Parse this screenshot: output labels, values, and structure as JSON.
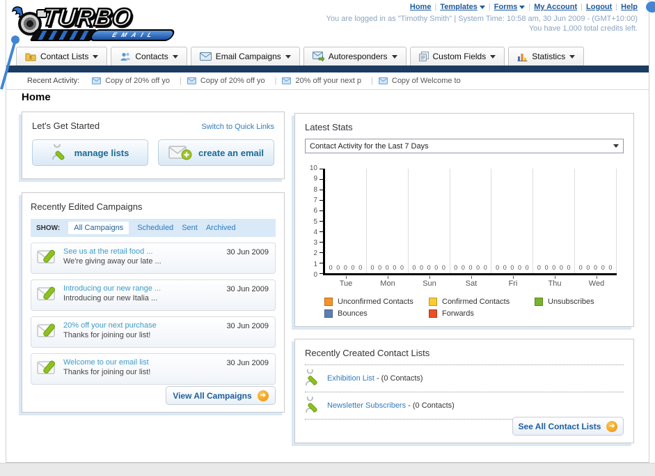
{
  "header": {
    "logo": {
      "top": "TURBO",
      "bottom": "EMAIL"
    },
    "nav": {
      "home": "Home",
      "templates": "Templates",
      "forms": "Forms",
      "my_account": "My Account",
      "logout": "Logout",
      "help": "Help"
    },
    "login_info": "You are logged in as \"Timothy Smith\" | System Time: 10:58 am, 30 Jun 2009 - (GMT+10:00)",
    "credits": "You have 1,000 total credits left."
  },
  "tabs": [
    {
      "label": "Contact Lists"
    },
    {
      "label": "Contacts"
    },
    {
      "label": "Email Campaigns"
    },
    {
      "label": "Autoresponders"
    },
    {
      "label": "Custom Fields"
    },
    {
      "label": "Statistics"
    }
  ],
  "recent_activity": {
    "label": "Recent Activity:",
    "items": [
      "Copy of 20% off yo",
      "Copy of 20% off yo",
      "20% off your next p",
      "Copy of Welcome to"
    ]
  },
  "page": {
    "title": "Home"
  },
  "get_started": {
    "title": "Let's Get Started",
    "switch_link": "Switch to Quick Links",
    "manage_lists_label": "manage lists",
    "create_email_label": "create an email"
  },
  "campaigns": {
    "title": "Recently Edited Campaigns",
    "show_label": "SHOW:",
    "filters": [
      "All Campaigns",
      "Scheduled",
      "Sent",
      "Archived"
    ],
    "active_filter": "All Campaigns",
    "items": [
      {
        "title": "See us at the retail food ...",
        "subtitle": "We're giving away our late ...",
        "date": "30 Jun 2009"
      },
      {
        "title": "Introducing our new range ...",
        "subtitle": "Introducing our new Italia ...",
        "date": "30 Jun 2009"
      },
      {
        "title": "20% off your next purchase",
        "subtitle": "Thanks for joining our list!",
        "date": "30 Jun 2009"
      },
      {
        "title": "Welcome to our email list",
        "subtitle": "Thanks for joining our list!",
        "date": "30 Jun 2009"
      }
    ],
    "view_all_label": "View All Campaigns"
  },
  "stats": {
    "title": "Latest Stats",
    "period_selected": "Contact Activity for the Last 7 Days"
  },
  "chart_data": {
    "type": "bar",
    "title": "Contact Activity for the Last 7 Days",
    "categories": [
      "Tue",
      "Mon",
      "Sun",
      "Sat",
      "Fri",
      "Thu",
      "Wed"
    ],
    "series": [
      {
        "name": "Unconfirmed Contacts",
        "color": "#F79226",
        "values": [
          0,
          0,
          0,
          0,
          0,
          0,
          0
        ]
      },
      {
        "name": "Confirmed Contacts",
        "color": "#FBCC32",
        "values": [
          0,
          0,
          0,
          0,
          0,
          0,
          0
        ]
      },
      {
        "name": "Unsubscribes",
        "color": "#77B32C",
        "values": [
          0,
          0,
          0,
          0,
          0,
          0,
          0
        ]
      },
      {
        "name": "Bounces",
        "color": "#5F7DB5",
        "values": [
          0,
          0,
          0,
          0,
          0,
          0,
          0
        ]
      },
      {
        "name": "Forwards",
        "color": "#EA4F28",
        "values": [
          0,
          0,
          0,
          0,
          0,
          0,
          0
        ]
      }
    ],
    "ylim": [
      0,
      10
    ],
    "yticks": [
      0,
      1,
      2,
      3,
      4,
      5,
      6,
      7,
      8,
      9,
      10
    ],
    "value_labels": true,
    "grid": "vertical-between-groups",
    "legend_position": "bottom"
  },
  "contact_lists": {
    "title": "Recently Created Contact Lists",
    "items": [
      {
        "name": "Exhibition List",
        "detail": "- (0 Contacts)"
      },
      {
        "name": "Newsletter Subscribers",
        "detail": "- (0 Contacts)"
      }
    ],
    "see_all_label": "See All Contact Lists"
  }
}
